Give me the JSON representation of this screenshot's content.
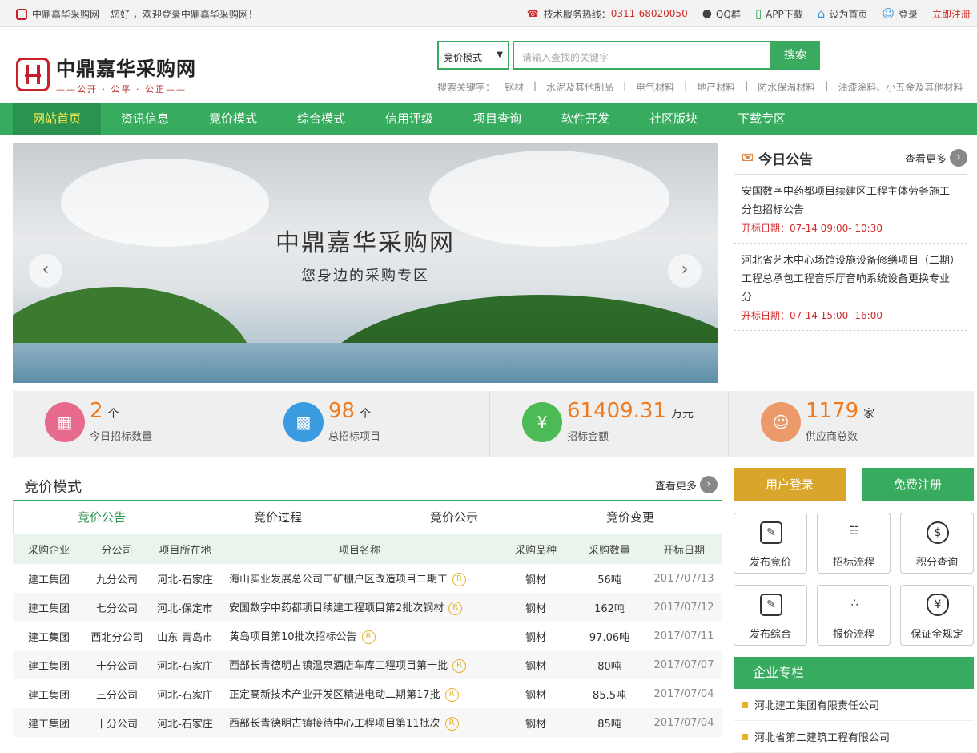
{
  "topbar": {
    "site": "中鼎嘉华采购网",
    "welcome": "您好 ，欢迎登录中鼎嘉华采购网！",
    "hotline_label": "技术服务热线：",
    "hotline": "0311-68020050",
    "qq": "QQ群",
    "app": "APP下载",
    "home": "设为首页",
    "login": "登录",
    "register": "立即注册"
  },
  "logo": {
    "title": "中鼎嘉华采购网",
    "slogan": "——公开 · 公平 · 公正——"
  },
  "search": {
    "mode": "竞价模式",
    "placeholder": "请输入查找的关键字",
    "button": "搜索",
    "hot_label": "搜索关键字：",
    "hot": [
      "钢材",
      "水泥及其他制品",
      "电气材料",
      "地产材料",
      "防水保温材料",
      "油漆涂料、小五金及其他材料"
    ]
  },
  "nav": [
    "网站首页",
    "资讯信息",
    "竞价模式",
    "综合模式",
    "信用评级",
    "项目查询",
    "软件开发",
    "社区版块",
    "下载专区"
  ],
  "banner": {
    "title": "中鼎嘉华采购网",
    "subtitle": "您身边的采购专区"
  },
  "notice": {
    "title": "今日公告",
    "more": "查看更多",
    "items": [
      {
        "text": "安国数字中药都项目续建区工程主体劳务施工分包招标公告",
        "date": "开标日期：07-14 09:00- 10:30"
      },
      {
        "text": "河北省艺术中心场馆设施设备修缮项目（二期）工程总承包工程音乐厅音响系统设备更换专业分",
        "date": "开标日期：07-14 15:00- 16:00"
      }
    ]
  },
  "stats": [
    {
      "num": "2",
      "unit": "个",
      "label": "今日招标数量",
      "color": "#e86a8c"
    },
    {
      "num": "98",
      "unit": "个",
      "label": "总招标项目",
      "color": "#3b9be0"
    },
    {
      "num": "61409.31",
      "unit": "万元",
      "label": "招标金额",
      "color": "#4dbb55"
    },
    {
      "num": "1179",
      "unit": "家",
      "label": "供应商总数",
      "color": "#ec9a6a"
    }
  ],
  "section": {
    "title": "竞价模式",
    "more": "查看更多",
    "tabs": [
      "竞价公告",
      "竞价过程",
      "竞价公示",
      "竞价变更"
    ],
    "headers": [
      "采购企业",
      "分公司",
      "项目所在地",
      "项目名称",
      "采购品种",
      "采购数量",
      "开标日期"
    ],
    "rows": [
      [
        "建工集团",
        "九分公司",
        "河北-石家庄",
        "海山实业发展总公司工矿棚户区改造项目二期工",
        "钢材",
        "56吨",
        "2017/07/13",
        "R"
      ],
      [
        "建工集团",
        "七分公司",
        "河北-保定市",
        "安国数字中药都项目续建工程项目第2批次钢材",
        "钢材",
        "162吨",
        "2017/07/12",
        "R"
      ],
      [
        "建工集团",
        "西北分公司",
        "山东-青岛市",
        "黄岛项目第10批次招标公告",
        "钢材",
        "97.06吨",
        "2017/07/11",
        "R"
      ],
      [
        "建工集团",
        "十分公司",
        "河北-石家庄",
        "西部长青德明古镇温泉酒店车库工程项目第十批",
        "钢材",
        "80吨",
        "2017/07/07",
        "R"
      ],
      [
        "建工集团",
        "三分公司",
        "河北-石家庄",
        "正定高新技术产业开发区精进电动二期第17批",
        "钢材",
        "85.5吨",
        "2017/07/04",
        "R"
      ],
      [
        "建工集团",
        "十分公司",
        "河北-石家庄",
        "西部长青德明古镇接待中心工程项目第11批次",
        "钢材",
        "85吨",
        "2017/07/04",
        "R"
      ]
    ]
  },
  "side": {
    "login": "用户登录",
    "register": "免费注册",
    "grid": [
      "发布竞价",
      "招标流程",
      "积分查询",
      "发布综合",
      "报价流程",
      "保证金规定"
    ],
    "ent_title": "企业专栏",
    "ent_items": [
      "河北建工集团有限责任公司",
      "河北省第二建筑工程有限公司"
    ]
  }
}
